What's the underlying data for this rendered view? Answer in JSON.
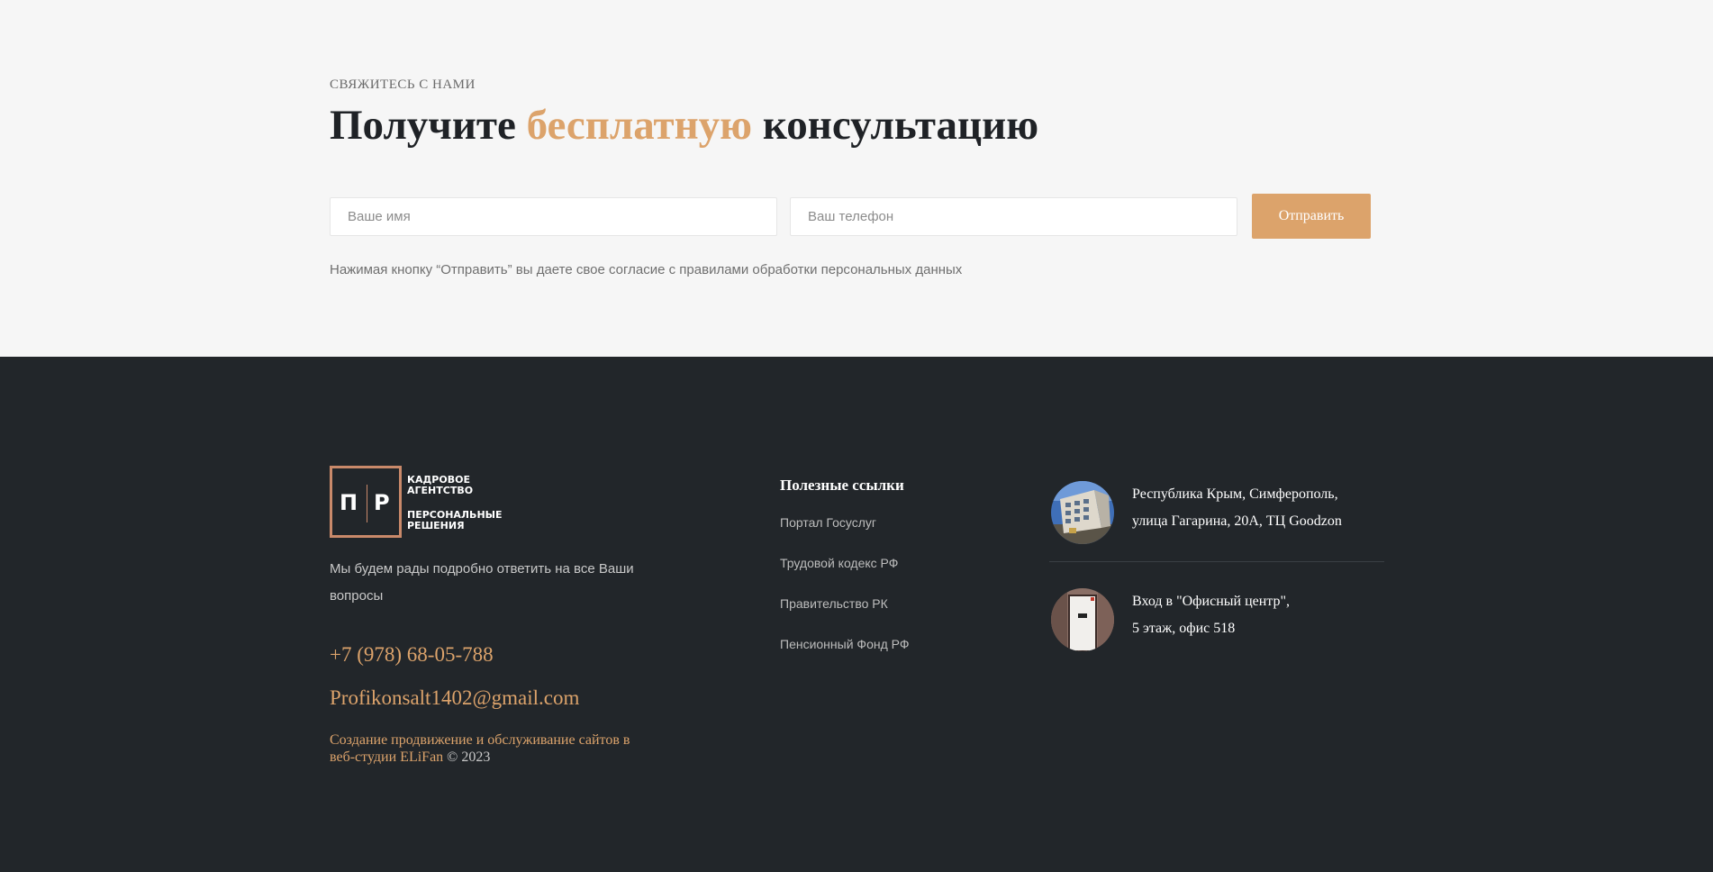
{
  "contact": {
    "eyebrow": "СВЯЖИТЕСЬ С НАМИ",
    "headline_pre": "Получите ",
    "headline_accent": "бесплатную",
    "headline_post": " консультацию",
    "name_placeholder": "Ваше имя",
    "phone_placeholder": "Ваш телефон",
    "send_label": "Отправить",
    "consent": "Нажимая кнопку “Отправить” вы даете свое согласие с правилами обработки персональных данных"
  },
  "footer": {
    "logo": {
      "letters": [
        "П",
        "Р"
      ],
      "line1": "КАДРОВОЕ",
      "line2": "АГЕНТСТВО",
      "line3": "ПЕРСОНАЛЬНЫЕ",
      "line4": "РЕШЕНИЯ"
    },
    "about_line1": "Мы будем рады подробно ответить на все Ваши",
    "about_line2": "вопросы",
    "phone": "+7 (978) 68-05-788",
    "email": "Profikonsalt1402@gmail.com",
    "credit_line1": "Создание продвижение и обслуживание сайтов в",
    "credit_line2": "веб-студии ELiFan",
    "credit_copy": " © 2023",
    "links_title": "Полезные ссылки",
    "links": [
      "Портал Госуслуг",
      "Трудовой кодекс РФ",
      "Правительство РК",
      "Пенсионный Фонд РФ"
    ],
    "locations": [
      {
        "line1": "Республика Крым, Симферополь,",
        "line2": "улица Гагарина, 20А, ТЦ Goodzon",
        "image": "building-photo"
      },
      {
        "line1": "Вход в \"Офисный центр\",",
        "line2": "5 этаж, офис 518",
        "image": "office-door-photo"
      }
    ]
  },
  "colors": {
    "accent": "#dca36b",
    "footer_bg": "#22262a",
    "contact_bg": "#f6f6f6",
    "logo_border": "#c9896a"
  }
}
